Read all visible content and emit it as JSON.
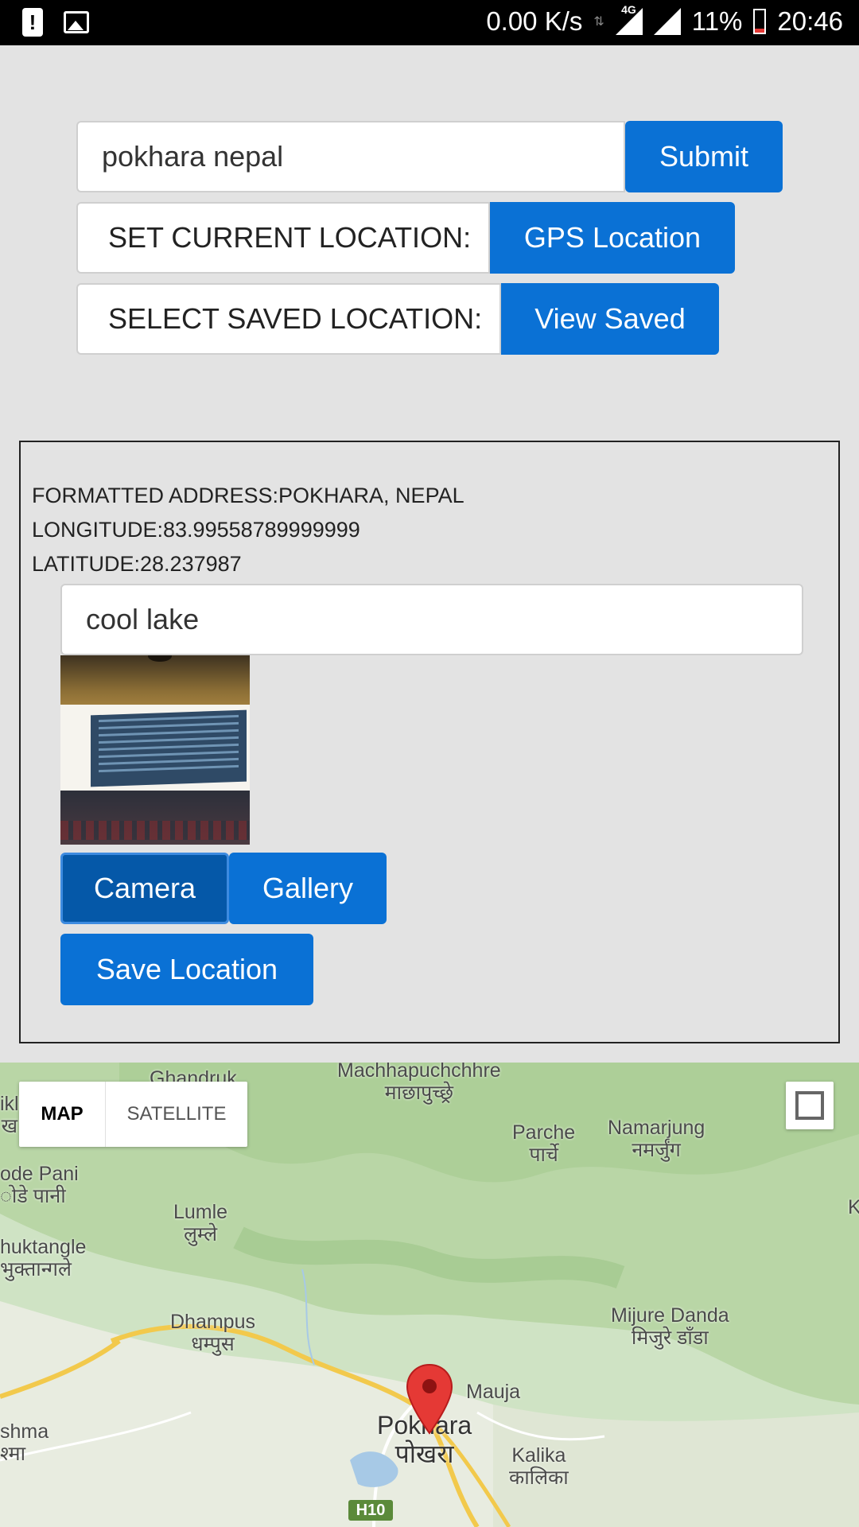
{
  "status_bar": {
    "net_speed": "0.00 K/s",
    "network_type": "4G",
    "battery": "11%",
    "time": "20:46",
    "icons": [
      "alert-icon",
      "image-icon",
      "data-arrows-icon",
      "signal-4g-icon",
      "signal-icon",
      "battery-icon"
    ]
  },
  "search": {
    "value": "pokhara nepal",
    "submit_label": "Submit"
  },
  "current_location": {
    "label": "SET CURRENT LOCATION:",
    "button_label": "GPS Location"
  },
  "saved_location": {
    "label": "SELECT SAVED LOCATION:",
    "button_label": "View Saved"
  },
  "details": {
    "formatted_address": "FORMATTED ADDRESS:POKHARA, NEPAL",
    "longitude": "LONGITUDE:83.99558789999999",
    "latitude": "LATITUDE:28.237987",
    "note_value": "cool lake",
    "camera_label": "Camera",
    "gallery_label": "Gallery",
    "save_label": "Save Location"
  },
  "map": {
    "type_map": "MAP",
    "type_satellite": "SATELLITE",
    "labels": {
      "ghandruk": "Ghandruk",
      "machhapuchchhre": "Machhapuchchhre",
      "machhapuchchhre_ne": "माछापुच्छ्रे",
      "parche": "Parche",
      "parche_ne": "पार्चे",
      "namarjung": "Namarjung",
      "namarjung_ne": "नमर्जुंग",
      "ikl": "ikl",
      "ikl_ne": "ख",
      "ode_pani": "ode Pani",
      "ode_pani_ne": "ोडे पानी",
      "lumle": "Lumle",
      "lumle_ne": "लुम्ले",
      "huktangle": "huktangle",
      "huktangle_ne": "भुक्तान्गले",
      "dhampus": "Dhampus",
      "dhampus_ne": "धम्पुस",
      "mijure_danda": "Mijure Danda",
      "mijure_danda_ne": "मिजुरे डाँडा",
      "mauja": "Mauja",
      "pokhara": "Pokhara",
      "pokhara_ne": "पोखरा",
      "shma": "shma",
      "shma_ne": "श्मा",
      "kalika": "Kalika",
      "kalika_ne": "कालिका",
      "edge_k": "K",
      "highway": "H10"
    }
  },
  "colors": {
    "accent": "#0a71d5",
    "accent_pressed": "#0558a8",
    "pin": "#e53935"
  }
}
